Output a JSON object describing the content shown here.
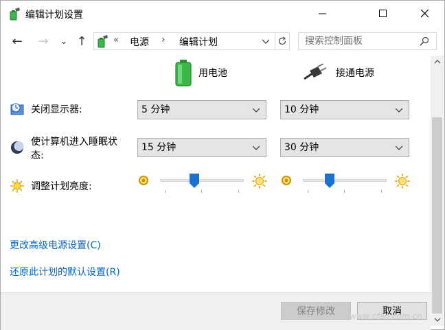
{
  "window": {
    "title": "编辑计划设置",
    "controls": {
      "minimize": "minimize-icon",
      "maximize": "maximize-icon",
      "close": "close-icon"
    }
  },
  "nav": {
    "back": "←",
    "forward": "→",
    "recent": "⌄",
    "up": "↑",
    "chevrons": "«",
    "breadcrumb": [
      "电源",
      "编辑计划"
    ],
    "separator": "›",
    "search_placeholder": "搜索控制面板"
  },
  "columns": {
    "battery": "用电池",
    "plugged": "接通电源"
  },
  "settings": {
    "display_off": {
      "label": "关闭显示器:",
      "battery": "5 分钟",
      "plugged": "10 分钟"
    },
    "sleep": {
      "label_line1": "使计算机进入睡眠状",
      "label_line2": "态:",
      "battery": "15 分钟",
      "plugged": "30 分钟"
    },
    "brightness": {
      "label": "调整计划亮度:",
      "battery_level": 0.4,
      "plugged_level": 0.3
    }
  },
  "links": {
    "advanced": "更改高级电源设置(C)",
    "restore": "还原此计划的默认设置(R)"
  },
  "buttons": {
    "save": "保存修改",
    "cancel": "取消"
  },
  "watermark": "www.cfan.com.cn",
  "colors": {
    "link": "#0066cc",
    "slider_thumb": "#1a73d1",
    "battery_green": "#3cb84a"
  }
}
